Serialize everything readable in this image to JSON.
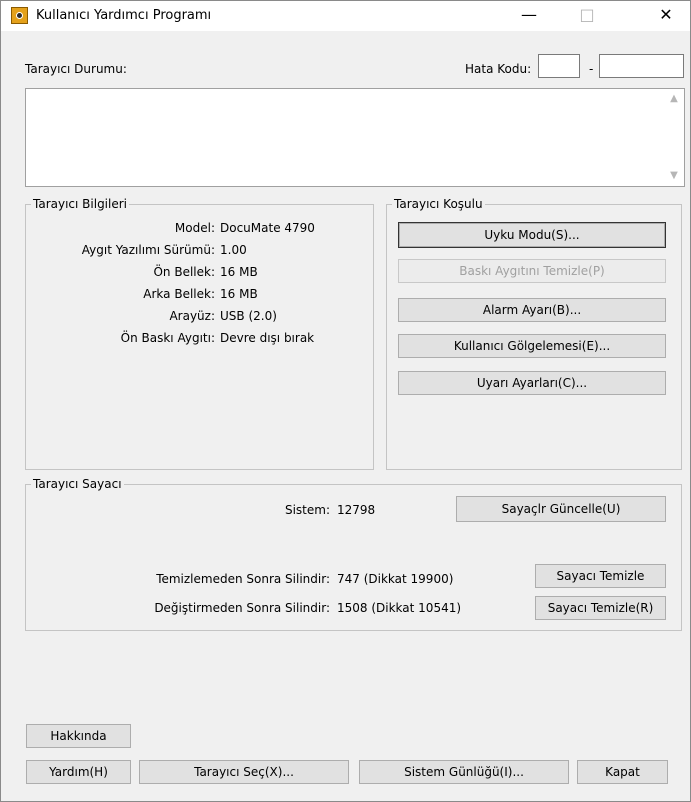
{
  "window": {
    "title": "Kullanıcı Yardımcı Programı",
    "minimize_glyph": "—",
    "maximize_glyph": "□",
    "close_glyph": "✕"
  },
  "status": {
    "label": "Tarayıcı Durumu:",
    "error_label": "Hata Kodu:",
    "error_separator": "-",
    "error_code_1": "",
    "error_code_2": "",
    "status_text": ""
  },
  "scanner_info": {
    "legend": "Tarayıcı Bilgileri",
    "rows": [
      {
        "label": "Model:",
        "value": "DocuMate 4790"
      },
      {
        "label": "Aygıt Yazılımı Sürümü:",
        "value": "1.00"
      },
      {
        "label": "Ön Bellek:",
        "value": "16 MB"
      },
      {
        "label": "Arka Bellek:",
        "value": "16 MB"
      },
      {
        "label": "Arayüz:",
        "value": "USB (2.0)"
      },
      {
        "label": "Ön Baskı Aygıtı:",
        "value": "Devre dışı bırak"
      }
    ]
  },
  "scanner_condition": {
    "legend": "Tarayıcı Koşulu",
    "sleep_mode": "Uyku Modu(S)...",
    "clean_printer": "Baskı Aygıtını Temizle(P)",
    "alarm_settings": "Alarm Ayarı(B)...",
    "user_shading": "Kullanıcı Gölgelemesi(E)...",
    "warning_settings": "Uyarı Ayarları(C)..."
  },
  "counter": {
    "legend": "Tarayıcı Sayacı",
    "system_label": "Sistem:",
    "system_value": "12798",
    "update_button": "Sayaçlr Güncelle(U)",
    "after_clean_label": "Temizlemeden Sonra Silindir:",
    "after_clean_value": "747 (Dikkat 19900)",
    "clear_counter_1": "Sayacı Temizle",
    "after_replace_label": "Değiştirmeden Sonra Silindir:",
    "after_replace_value": "1508 (Dikkat 10541)",
    "clear_counter_2": "Sayacı Temizle(R)"
  },
  "footer": {
    "about": "Hakkında",
    "help": "Yardım(H)",
    "select_scanner": "Tarayıcı Seç(X)...",
    "system_log": "Sistem Günlüğü(I)...",
    "close": "Kapat"
  }
}
